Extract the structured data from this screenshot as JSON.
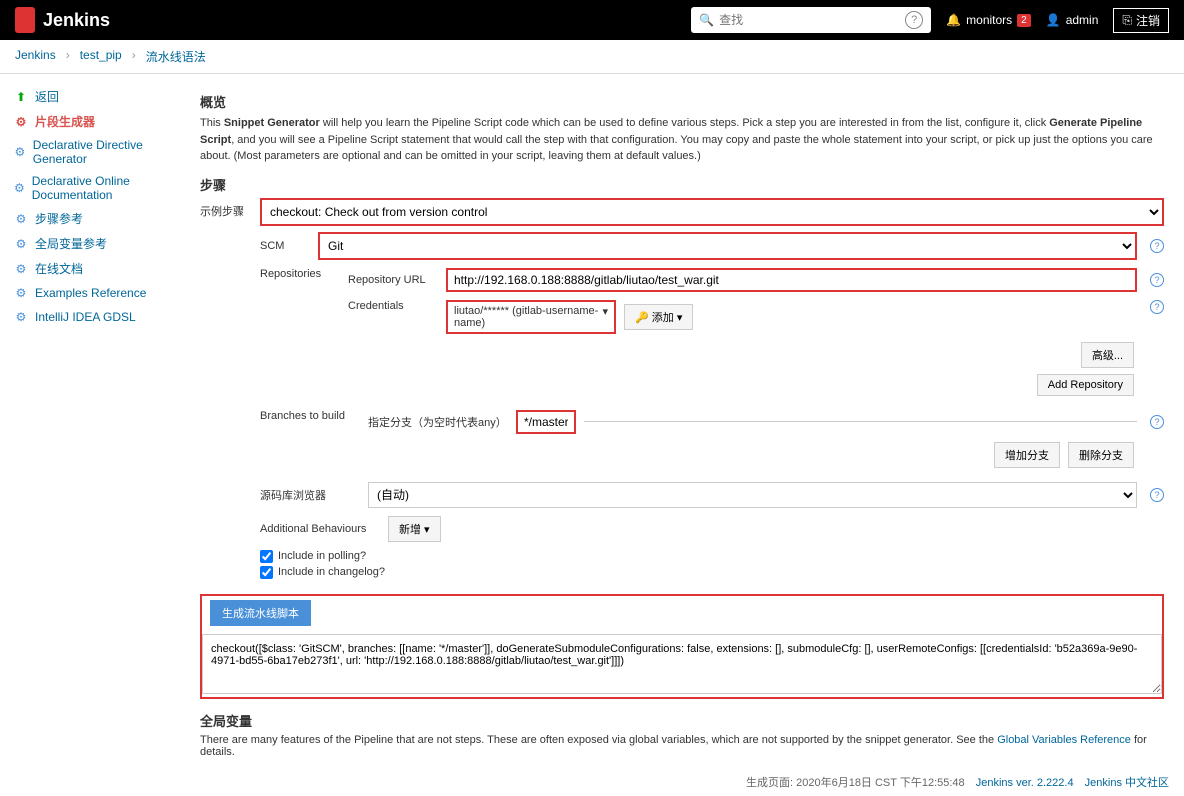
{
  "header": {
    "title": "Jenkins",
    "search_placeholder": "查找",
    "monitors_label": "monitors",
    "monitors_count": "2",
    "user": "admin",
    "logout": "注销"
  },
  "breadcrumb": {
    "items": [
      "Jenkins",
      "test_pip",
      "流水线语法"
    ]
  },
  "sidebar": {
    "items": [
      {
        "label": "返回",
        "icon": "arrow-up"
      },
      {
        "label": "片段生成器",
        "icon": "gear",
        "active": true
      },
      {
        "label": "Declarative Directive Generator",
        "icon": "gear"
      },
      {
        "label": "Declarative Online Documentation",
        "icon": "gear"
      },
      {
        "label": "步骤参考",
        "icon": "gear"
      },
      {
        "label": "全局变量参考",
        "icon": "gear"
      },
      {
        "label": "在线文档",
        "icon": "gear"
      },
      {
        "label": "Examples Reference",
        "icon": "gear"
      },
      {
        "label": "IntelliJ IDEA GDSL",
        "icon": "gear"
      }
    ]
  },
  "content": {
    "overview_title": "概览",
    "intro_prefix": "This ",
    "intro_bold1": "Snippet Generator",
    "intro_mid": " will help you learn the Pipeline Script code which can be used to define various steps. Pick a step you are interested in from the list, configure it, click ",
    "intro_bold2": "Generate Pipeline Script",
    "intro_suffix": ", and you will see a Pipeline Script statement that would call the step with that configuration. You may copy and paste the whole statement into your script, or pick up just the options you care about. (Most parameters are optional and can be omitted in your script, leaving them at default values.)",
    "steps_title": "步骤",
    "sample_step_label": "示例步骤",
    "sample_step_value": "checkout: Check out from version control",
    "scm_label": "SCM",
    "scm_value": "Git",
    "repositories_label": "Repositories",
    "repo_url_label": "Repository URL",
    "repo_url_value": "http://192.168.0.188:8888/gitlab/liutao/test_war.git",
    "credentials_label": "Credentials",
    "credentials_value": "liutao/****** (gitlab-username-name)",
    "add_button": "添加",
    "advanced_button": "高级...",
    "add_repo_button": "Add Repository",
    "branches_label": "Branches to build",
    "branch_spec_label": "指定分支（为空时代表any）",
    "branch_value": "*/master",
    "add_branch_button": "增加分支",
    "delete_branch_button": "删除分支",
    "repo_browser_label": "源码库浏览器",
    "repo_browser_value": "(自动)",
    "additional_label": "Additional Behaviours",
    "additional_button": "新增",
    "include_polling": "Include in polling?",
    "include_changelog": "Include in changelog?",
    "generate_button": "生成流水线脚本",
    "script_output": "checkout([$class: 'GitSCM', branches: [[name: '*/master']], doGenerateSubmoduleConfigurations: false, extensions: [], submoduleCfg: [], userRemoteConfigs: [[credentialsId: 'b52a369a-9e90-4971-bd55-6ba17eb273f1', url: 'http://192.168.0.188:8888/gitlab/liutao/test_war.git']]])",
    "global_vars_title": "全局变量",
    "global_vars_prefix": "There are many features of the Pipeline that are not steps. These are often exposed via global variables, which are not supported by the snippet generator. See the ",
    "global_vars_link": "Global Variables Reference",
    "global_vars_suffix": " for details."
  },
  "footer": {
    "timestamp": "生成页面: 2020年6月18日 CST 下午12:55:48",
    "version_link": "Jenkins ver. 2.222.4",
    "community_link": "Jenkins 中文社区"
  }
}
